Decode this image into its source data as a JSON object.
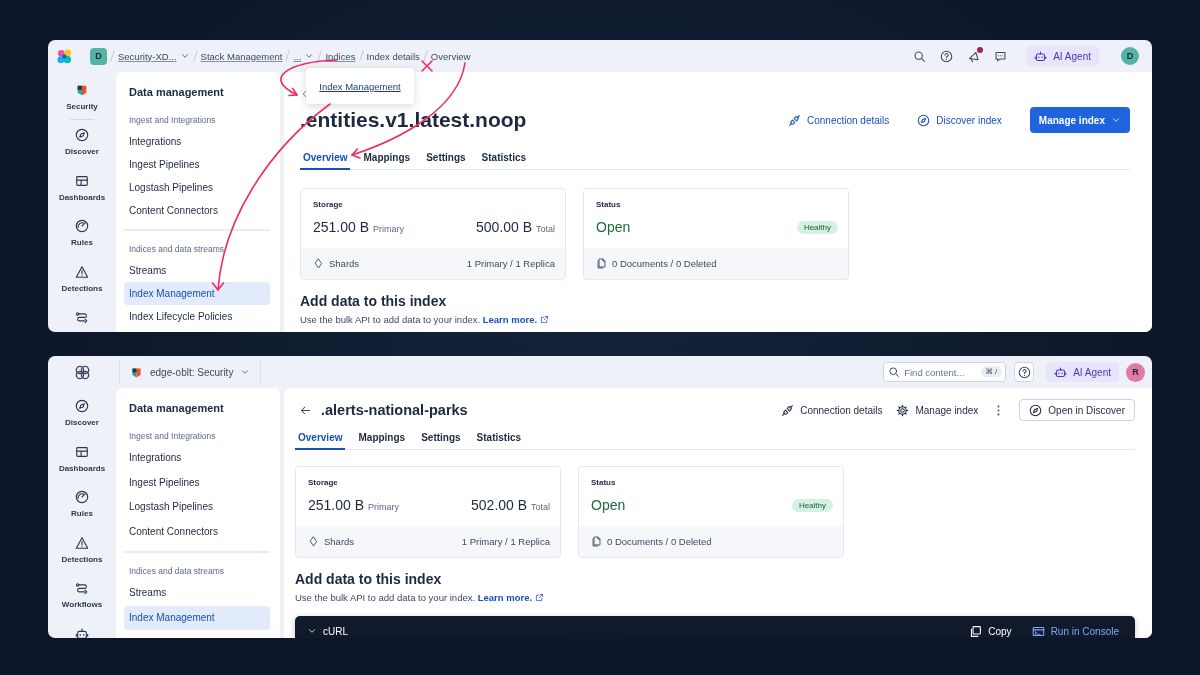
{
  "panels": [
    {
      "kind": "breadcrumbs",
      "annotation_arrows": true,
      "header": {
        "space_avatar": "D",
        "breadcrumbs": [
          {
            "label": "Security-XD...",
            "link": true,
            "dropdown": true
          },
          {
            "label": "Stack Management",
            "link": true,
            "dropdown": false
          },
          {
            "label": "...",
            "link": true,
            "dropdown": true
          },
          {
            "label": "Indices",
            "link": true,
            "dropdown": false
          },
          {
            "label": "Index details",
            "link": false,
            "dropdown": false
          },
          {
            "label": "Overview",
            "link": false,
            "dropdown": false
          }
        ],
        "news_dot": true,
        "agent": "AI Agent",
        "user": {
          "initial": "D",
          "color": "#54b3a6"
        }
      },
      "popover": {
        "link": "Index Management"
      },
      "rail": [
        {
          "kind": "security",
          "label": "Security"
        },
        {
          "kind": "discover",
          "label": "Discover"
        },
        {
          "kind": "dashboards",
          "label": "Dashboards"
        },
        {
          "kind": "rules",
          "label": "Rules"
        },
        {
          "kind": "detections",
          "label": "Detections"
        },
        {
          "kind": "workflows"
        }
      ],
      "sidebar": {
        "title": "Data management",
        "groups": [
          {
            "title": "Ingest and Integrations",
            "items": [
              {
                "label": "Integrations",
                "selected": false
              },
              {
                "label": "Ingest Pipelines",
                "selected": false
              },
              {
                "label": "Logstash Pipelines",
                "selected": false
              },
              {
                "label": "Content Connectors",
                "selected": false
              }
            ]
          },
          {
            "title": "Indices and data streams",
            "items": [
              {
                "label": "Streams",
                "selected": false
              },
              {
                "label": "Index Management",
                "selected": true
              },
              {
                "label": "Index Lifecycle Policies",
                "selected": false
              }
            ]
          }
        ]
      },
      "page": {
        "title": ".entities.v1.latest.noop",
        "actions": [
          {
            "kind": "connection",
            "label": "Connection details"
          },
          {
            "kind": "discover",
            "label": "Discover index"
          },
          {
            "kind": "manage",
            "label": "Manage index",
            "dropdown": true
          }
        ],
        "tabs": [
          {
            "label": "Overview",
            "selected": true
          },
          {
            "label": "Mappings",
            "selected": false
          },
          {
            "label": "Settings",
            "selected": false
          },
          {
            "label": "Statistics",
            "selected": false
          }
        ],
        "storage": {
          "title": "Storage",
          "primary_value": "251.00 B",
          "primary_label": "Primary",
          "total_value": "500.00 B",
          "total_label": "Total",
          "footer_label": "Shards",
          "footer_value": "1 Primary / 1 Replica"
        },
        "status": {
          "title": "Status",
          "value": "Open",
          "badge": "Healthy",
          "footer": "0 Documents / 0 Deleted"
        },
        "add_data": {
          "heading": "Add data to this index",
          "text": "Use the bulk API to add data to your index.",
          "link": "Learn more."
        }
      }
    },
    {
      "kind": "space",
      "header": {
        "space": "edge-oblt: Security",
        "search": {
          "placeholder": "Find content...",
          "shortcut": "⌘ /"
        },
        "agent": "AI Agent",
        "user": {
          "initial": "R",
          "color": "#e27ba4"
        }
      },
      "rail": [
        {
          "kind": "discover",
          "label": "Discover"
        },
        {
          "kind": "dashboards",
          "label": "Dashboards"
        },
        {
          "kind": "rules",
          "label": "Rules"
        },
        {
          "kind": "detections",
          "label": "Detections"
        },
        {
          "kind": "workflows",
          "label": "Workflows"
        },
        {
          "kind": "agent"
        }
      ],
      "sidebar": {
        "title": "Data management",
        "groups": [
          {
            "title": "Ingest and Integrations",
            "items": [
              {
                "label": "Integrations",
                "selected": false
              },
              {
                "label": "Ingest Pipelines",
                "selected": false
              },
              {
                "label": "Logstash Pipelines",
                "selected": false
              },
              {
                "label": "Content Connectors",
                "selected": false
              }
            ]
          },
          {
            "title": "Indices and data streams",
            "items": [
              {
                "label": "Streams",
                "selected": false
              },
              {
                "label": "Index Management",
                "selected": true
              }
            ]
          }
        ]
      },
      "page": {
        "title": ".alerts-national-parks",
        "actions": [
          {
            "kind": "connection",
            "label": "Connection details"
          },
          {
            "kind": "manage",
            "label": "Manage index",
            "dropdown": false
          },
          {
            "kind": "more"
          },
          {
            "kind": "discover",
            "label": "Open in Discover"
          }
        ],
        "tabs": [
          {
            "label": "Overview",
            "selected": true
          },
          {
            "label": "Mappings",
            "selected": false
          },
          {
            "label": "Settings",
            "selected": false
          },
          {
            "label": "Statistics",
            "selected": false
          }
        ],
        "storage": {
          "title": "Storage",
          "primary_value": "251.00 B",
          "primary_label": "Primary",
          "total_value": "502.00 B",
          "total_label": "Total",
          "footer_label": "Shards",
          "footer_value": "1 Primary / 1 Replica"
        },
        "status": {
          "title": "Status",
          "value": "Open",
          "badge": "Healthy",
          "footer": "0 Documents / 0 Deleted"
        },
        "add_data": {
          "heading": "Add data to this index",
          "text": "Use the bulk API to add data to your index.",
          "link": "Learn more."
        },
        "code": {
          "language": "cURL",
          "copy": "Copy",
          "run": "Run in Console"
        }
      }
    }
  ]
}
